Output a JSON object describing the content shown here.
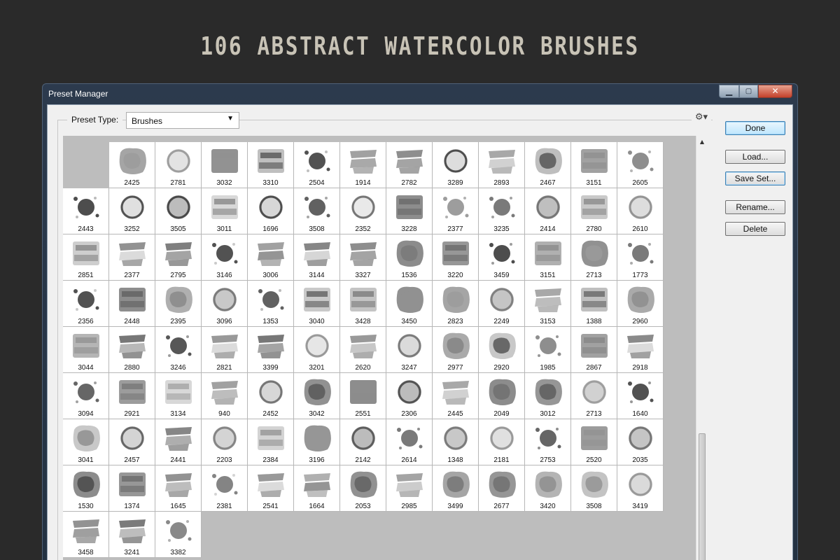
{
  "banner": {
    "title": "106 ABSTRACT WATERCOLOR BRUSHES"
  },
  "window": {
    "title": "Preset Manager",
    "controls": {
      "minimize": "▁",
      "maximize": "▢",
      "close": "✕"
    }
  },
  "preset_type": {
    "label": "Preset Type:",
    "value": "Brushes"
  },
  "icons": {
    "gear": "gear-icon",
    "dropdown": "chevron-down-icon"
  },
  "buttons": {
    "done": "Done",
    "load": "Load...",
    "save_set": "Save Set...",
    "rename": "Rename...",
    "delete": "Delete"
  },
  "brushes": [
    "2425",
    "2781",
    "3032",
    "3310",
    "2504",
    "1914",
    "2782",
    "3289",
    "2893",
    "2467",
    "3151",
    "2605",
    "2443",
    "3252",
    "3505",
    "3011",
    "1696",
    "3508",
    "2352",
    "3228",
    "2377",
    "3235",
    "2414",
    "2780",
    "2610",
    "2851",
    "2377",
    "2795",
    "3146",
    "3006",
    "3144",
    "3327",
    "1536",
    "3220",
    "3459",
    "3151",
    "2713",
    "1773",
    "2356",
    "2448",
    "2395",
    "3096",
    "1353",
    "3040",
    "3428",
    "3450",
    "2823",
    "2249",
    "3153",
    "1388",
    "2960",
    "3044",
    "2880",
    "3246",
    "2821",
    "3399",
    "3201",
    "2620",
    "3247",
    "2977",
    "2920",
    "1985",
    "2867",
    "2918",
    "3094",
    "2921",
    "3134",
    "940",
    "2452",
    "3042",
    "2551",
    "2306",
    "2445",
    "2049",
    "3012",
    "2713",
    "1640",
    "3041",
    "2457",
    "2441",
    "2203",
    "2384",
    "3196",
    "2142",
    "2614",
    "1348",
    "2181",
    "2753",
    "2520",
    "2035",
    "1530",
    "1374",
    "1645",
    "2381",
    "2541",
    "1664",
    "2053",
    "2985",
    "3499",
    "2677",
    "3420",
    "3508",
    "3419",
    "3458",
    "3241",
    "3382"
  ]
}
